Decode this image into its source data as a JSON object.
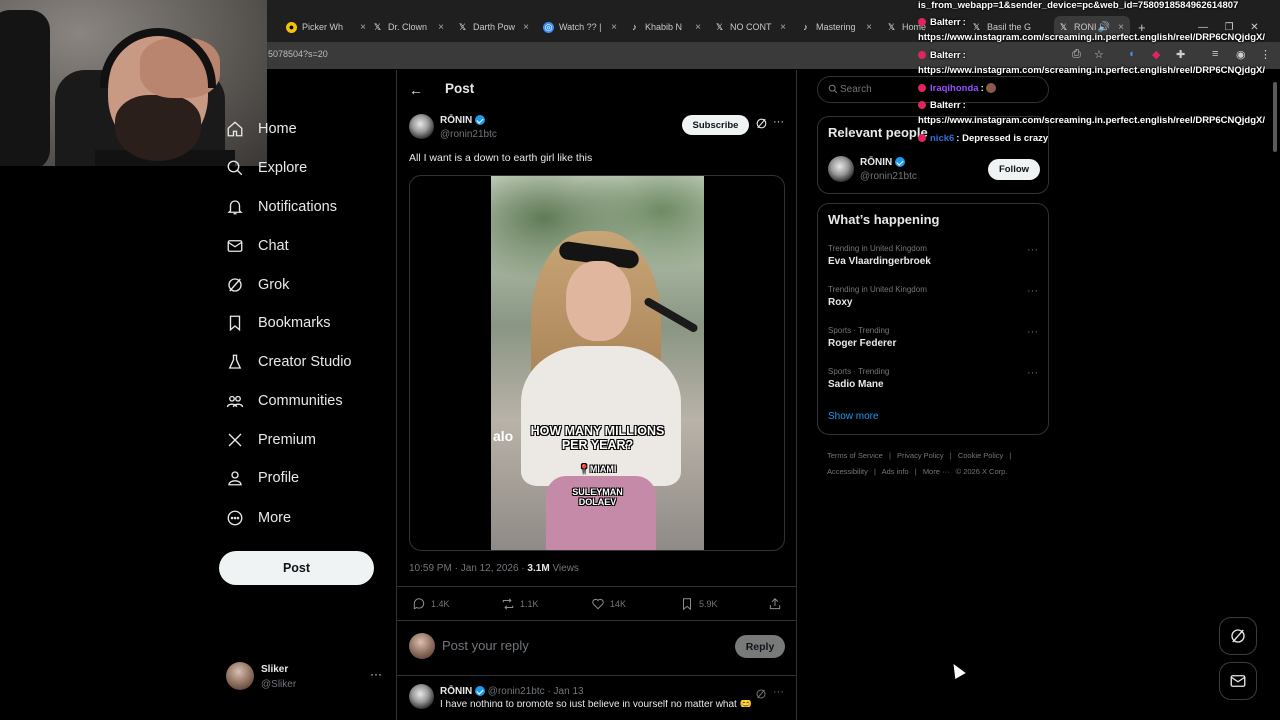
{
  "browser": {
    "tabs": [
      {
        "label": "Picker Wh",
        "icon": "picker-icon"
      },
      {
        "label": "Dr. Clown",
        "icon": "x-logo-icon"
      },
      {
        "label": "Darth Pow",
        "icon": "x-logo-icon"
      },
      {
        "label": "Watch ?? |",
        "icon": "watch-icon"
      },
      {
        "label": "Khabib N",
        "icon": "tiktok-icon"
      },
      {
        "label": "NO CONT",
        "icon": "x-logo-icon"
      },
      {
        "label": "Mastering",
        "icon": "tiktok-icon"
      },
      {
        "label": "Home",
        "icon": "x-logo-icon"
      },
      {
        "label": "Basil the G",
        "icon": "x-logo-icon"
      },
      {
        "label": "RONI",
        "icon": "x-logo-icon"
      }
    ],
    "url_fragment": "5078504?s=20",
    "new_tab_glyph": "+"
  },
  "chat_overlay": [
    {
      "text": "is_from_webapp=1&sender_device=pc&web_id=7580918584962614807"
    },
    {
      "user": "Balterr",
      "text": "https://www.instagram.com/screaming.in.perfect.english/reel/DRP6CNQjdgX/"
    },
    {
      "user": "Balterr",
      "text": "https://www.instagram.com/screaming.in.perfect.english/reel/DRP6CNQjdgX/"
    },
    {
      "user": "Iraqihonda",
      "text": ""
    },
    {
      "user": "Balterr",
      "text": "https://www.instagram.com/screaming.in.perfect.english/reel/DRP6CNQjdgX/"
    },
    {
      "user": "nick6",
      "text": "Depressed is crazy"
    }
  ],
  "nav": {
    "items": [
      {
        "label": "Home",
        "icon": "home-icon"
      },
      {
        "label": "Explore",
        "icon": "search-icon"
      },
      {
        "label": "Notifications",
        "icon": "bell-icon"
      },
      {
        "label": "Chat",
        "icon": "mail-icon"
      },
      {
        "label": "Grok",
        "icon": "grok-icon"
      },
      {
        "label": "Bookmarks",
        "icon": "bookmark-icon"
      },
      {
        "label": "Creator Studio",
        "icon": "flask-icon"
      },
      {
        "label": "Communities",
        "icon": "people-icon"
      },
      {
        "label": "Premium",
        "icon": "x-logo-icon"
      },
      {
        "label": "Profile",
        "icon": "person-icon"
      },
      {
        "label": "More",
        "icon": "more-circle-icon"
      }
    ],
    "post_button": "Post",
    "account": {
      "name": "Sliker",
      "handle": "@Sliker"
    }
  },
  "main": {
    "header_title": "Post",
    "post": {
      "author": "RŌNIN",
      "handle": "@ronin21btc",
      "subscribe_label": "Subscribe",
      "text": "All I want is a down to earth girl like this",
      "media_captions": {
        "line1": "HOW MANY MILLIONS",
        "line2": "PER YEAR?",
        "location": "MIAMI",
        "credit1": "SULEYMAN",
        "credit2": "DOLAEV",
        "brand": "alo"
      },
      "timestamp": "10:59 PM · Jan 12, 2026",
      "views_count": "3.1M",
      "views_label": "Views",
      "stats": {
        "replies": "1.4K",
        "reposts": "1.1K",
        "likes": "14K",
        "bookmarks": "5.9K"
      }
    },
    "reply_box": {
      "placeholder": "Post your reply",
      "button": "Reply"
    },
    "reply": {
      "author": "RŌNIN",
      "handle": "@ronin21btc",
      "date": "· Jan 13",
      "text": "I have nothing to promote so just believe in yourself no matter what 😊"
    }
  },
  "right": {
    "search_placeholder": "Search",
    "relevant_title": "Relevant people",
    "relevant_person": {
      "name": "RŌNIN",
      "handle": "@ronin21btc",
      "follow_label": "Follow"
    },
    "happening_title": "What’s happening",
    "trends": [
      {
        "meta": "Trending in United Kingdom",
        "name": "Eva Vlaardingerbroek"
      },
      {
        "meta": "Trending in United Kingdom",
        "name": "Roxy"
      },
      {
        "meta": "Sports · Trending",
        "name": "Roger Federer"
      },
      {
        "meta": "Sports · Trending",
        "name": "Sadio Mane"
      }
    ],
    "show_more": "Show more",
    "footer": [
      "Terms of Service",
      "|",
      "Privacy Policy",
      "|",
      "Cookie Policy",
      "|",
      "Accessibility",
      "|",
      "Ads info",
      "|",
      "More ···",
      "© 2026 X Corp."
    ]
  },
  "colors": {
    "accent": "#1d9bf0",
    "background": "#000000",
    "border": "#2f3336",
    "muted": "#71767b",
    "chat_user": "#9b4dff"
  }
}
